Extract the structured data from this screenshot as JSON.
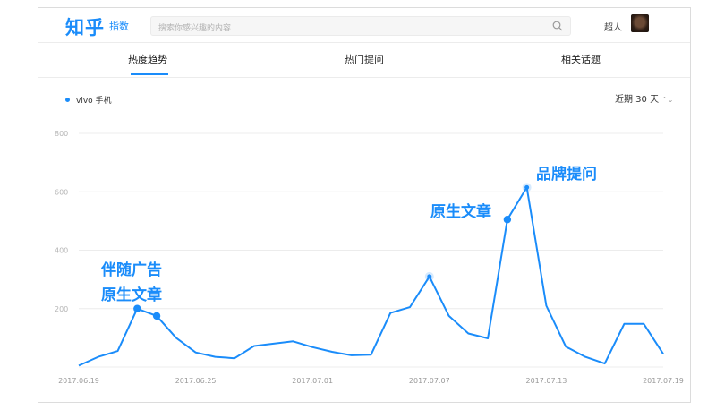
{
  "brand": {
    "logo": "知乎",
    "sub": "指数"
  },
  "search": {
    "placeholder": "搜索你感兴趣的内容"
  },
  "user": {
    "name": "超人"
  },
  "tabs": [
    {
      "label": "热度趋势",
      "active": true
    },
    {
      "label": "热门提问",
      "active": false
    },
    {
      "label": "相关话题",
      "active": false
    }
  ],
  "legend": {
    "label": "vivo 手机"
  },
  "range": {
    "label": "近期 30 天"
  },
  "colors": {
    "accent": "#1a8cfa",
    "grid": "#ececec",
    "axis_text": "#b5b5b5"
  },
  "annotations": {
    "first_line1": "伴随广告",
    "first_line2": "原生文章",
    "second": "原生文章",
    "third": "品牌提问"
  },
  "chart_data": {
    "type": "line",
    "ylim": [
      0,
      800
    ],
    "yticks": [
      200,
      400,
      600,
      800
    ],
    "x": [
      "2017.06.19",
      "2017.06.20",
      "2017.06.21",
      "2017.06.22",
      "2017.06.23",
      "2017.06.24",
      "2017.06.25",
      "2017.06.26",
      "2017.06.27",
      "2017.06.28",
      "2017.06.29",
      "2017.06.30",
      "2017.07.01",
      "2017.07.02",
      "2017.07.03",
      "2017.07.04",
      "2017.07.05",
      "2017.07.06",
      "2017.07.07",
      "2017.07.08",
      "2017.07.09",
      "2017.07.10",
      "2017.07.11",
      "2017.07.12",
      "2017.07.13",
      "2017.07.14",
      "2017.07.15",
      "2017.07.16",
      "2017.07.17",
      "2017.07.18",
      "2017.07.19"
    ],
    "xtick_labels": [
      "2017.06.19",
      "2017.06.25",
      "2017.07.01",
      "2017.07.07",
      "2017.07.13",
      "2017.07.19"
    ],
    "series": [
      {
        "name": "vivo 手机",
        "values": [
          5,
          35,
          55,
          200,
          175,
          100,
          50,
          35,
          30,
          72,
          80,
          88,
          68,
          52,
          40,
          42,
          185,
          205,
          310,
          175,
          115,
          98,
          505,
          615,
          210,
          70,
          35,
          12,
          148,
          148,
          45
        ]
      }
    ],
    "markers": [
      3,
      4,
      22
    ],
    "highlights": [
      18,
      23
    ]
  }
}
